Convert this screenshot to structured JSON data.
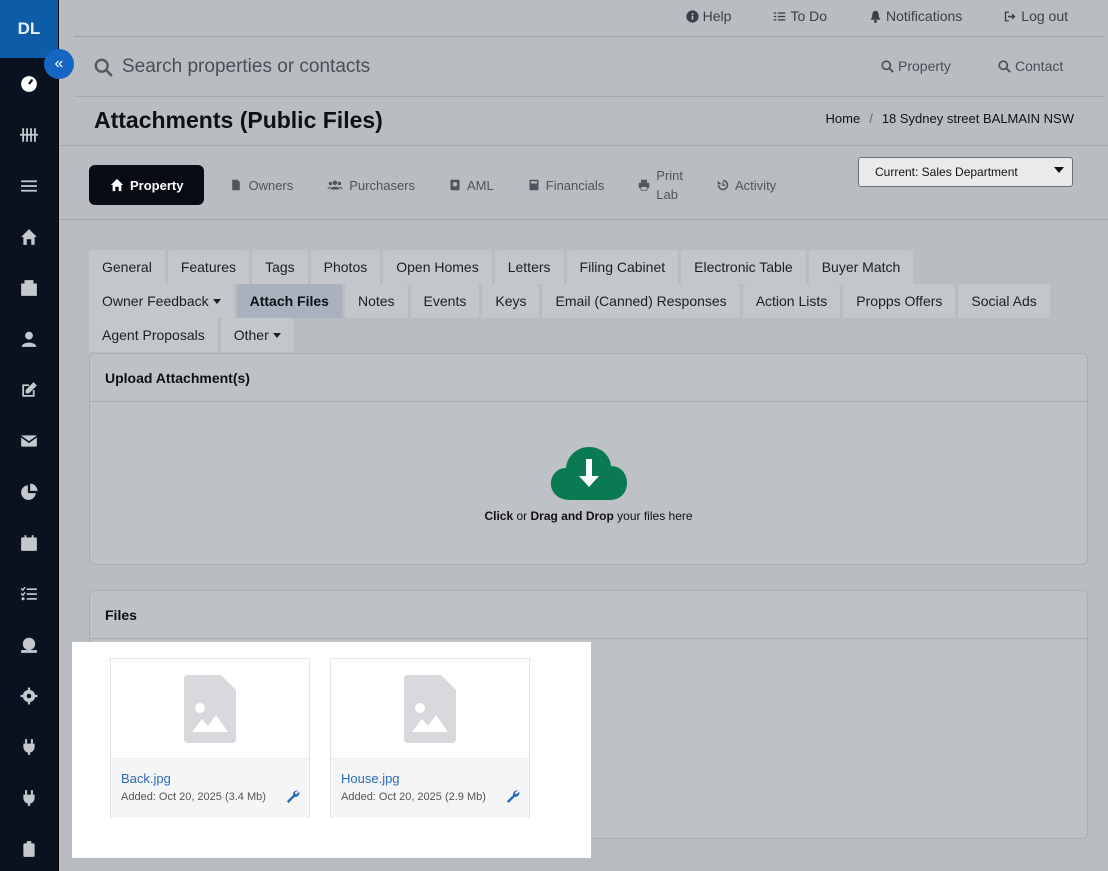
{
  "sidebar": {
    "logo": "DL",
    "collapse_icon": "«",
    "items": [
      {
        "name": "dashboard-icon"
      },
      {
        "name": "tally-icon"
      },
      {
        "name": "list-icon"
      },
      {
        "name": "home-icon"
      },
      {
        "name": "building-icon"
      },
      {
        "name": "user-icon"
      },
      {
        "name": "edit-icon"
      },
      {
        "name": "envelope-icon"
      },
      {
        "name": "pie-chart-icon"
      },
      {
        "name": "calendar-icon"
      },
      {
        "name": "checklist-icon"
      },
      {
        "name": "money-icon"
      },
      {
        "name": "settings-icon"
      },
      {
        "name": "plug-icon"
      },
      {
        "name": "plug-icon"
      },
      {
        "name": "clipboard-icon"
      }
    ]
  },
  "topbar": {
    "help": "Help",
    "todo": "To Do",
    "notifications": "Notifications",
    "logout": "Log out"
  },
  "search": {
    "placeholder": "Search properties or contacts",
    "property_btn": "Property",
    "contact_btn": "Contact"
  },
  "page": {
    "title": "Attachments (Public Files)",
    "breadcrumb_home": "Home",
    "breadcrumb_sep": "/",
    "breadcrumb_current": "18 Sydney street BALMAIN NSW"
  },
  "maintabs": {
    "property": "Property",
    "owners": "Owners",
    "purchasers": "Purchasers",
    "aml": "AML",
    "financials": "Financials",
    "print_1": "Print",
    "print_2": "Lab",
    "activity": "Activity"
  },
  "department": {
    "selected": "Current: Sales Department"
  },
  "subtabs": {
    "row1": [
      "General",
      "Features",
      "Tags",
      "Photos",
      "Open Homes",
      "Letters",
      "Filing Cabinet",
      "Electronic Table",
      "Buyer Match"
    ],
    "row2": [
      "Owner Feedback",
      "Attach Files",
      "Notes",
      "Events",
      "Keys",
      "Email (Canned) Responses",
      "Action Lists",
      "Propps Offers",
      "Social Ads"
    ],
    "row3": [
      "Agent Proposals",
      "Other"
    ]
  },
  "upload": {
    "heading": "Upload Attachment(s)",
    "click": "Click",
    "or": "or",
    "drag": "Drag and Drop",
    "suffix": "your files here"
  },
  "files": {
    "heading": "Files",
    "items": [
      {
        "name": "Back.jpg",
        "added": "Added: Oct 20, 2025 (3.4 Mb)"
      },
      {
        "name": "House.jpg",
        "added": "Added: Oct 20, 2025 (2.9 Mb)"
      }
    ]
  },
  "colors": {
    "sidebar_bg": "#0a1220",
    "logo_bg": "#0c5ca8",
    "upload_icon": "#0a7a52",
    "link": "#2b6cb3"
  }
}
